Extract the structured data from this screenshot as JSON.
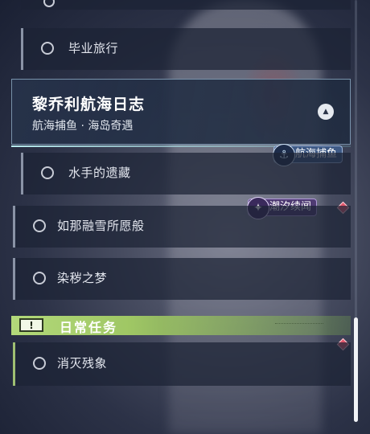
{
  "quest_list": {
    "items_above": [
      {
        "label": "毕业旅行"
      }
    ],
    "expanded": {
      "title": "黎乔利航海日志",
      "subtitle": "航海捕鱼 · 海岛奇遇",
      "collapse_icon": "chevron-up-icon"
    },
    "sub_items": [
      {
        "label": "水手的遗藏"
      }
    ],
    "items_below": [
      {
        "label": "如那融雪所愿般"
      },
      {
        "label": "染秽之梦"
      }
    ],
    "tags": {
      "fishing": "航海捕鱼",
      "tide": "潮汐续闻"
    }
  },
  "daily": {
    "section_title": "日常任务",
    "items": [
      {
        "label": "消灭残象"
      }
    ]
  },
  "colors": {
    "daily_accent": "#b3d97a",
    "notice_diamond": "#e0566b",
    "fishing_tag": "#3f5a86",
    "tide_tag": "#4f3b73"
  }
}
